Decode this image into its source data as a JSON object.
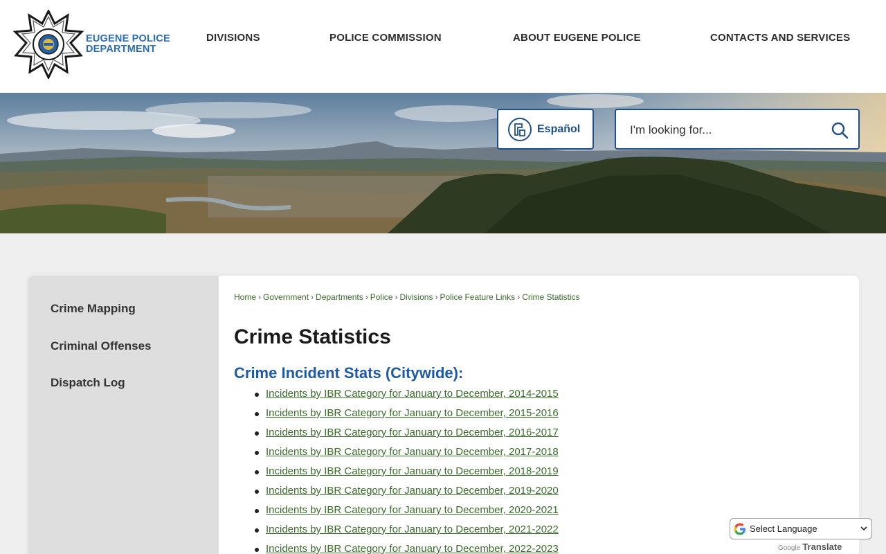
{
  "header": {
    "logo_line1": "EUGENE POLICE",
    "logo_line2": "DEPARTMENT",
    "nav": [
      {
        "label": "DIVISIONS"
      },
      {
        "label": "POLICE COMMISSION"
      },
      {
        "label": "ABOUT EUGENE POLICE"
      },
      {
        "label": "CONTACTS AND SERVICES"
      }
    ]
  },
  "banner": {
    "language_button": "Español",
    "search_placeholder": "I'm looking for..."
  },
  "sidebar": {
    "items": [
      {
        "label": "Crime Mapping"
      },
      {
        "label": "Criminal Offenses"
      },
      {
        "label": "Dispatch Log"
      }
    ]
  },
  "breadcrumb": [
    "Home",
    "Government",
    "Departments",
    "Police",
    "Divisions",
    "Police Feature Links",
    "Crime Statistics"
  ],
  "main": {
    "title": "Crime Statistics",
    "section_title": "Crime Incident Stats (Citywide):",
    "links": [
      "Incidents by IBR Category for January to December, 2014-2015",
      "Incidents by IBR Category for January to December, 2015-2016",
      "Incidents by IBR Category for January to December, 2016-2017",
      "Incidents by IBR Category for January to December, 2017-2018",
      "Incidents by IBR Category for January to December, 2018-2019",
      "Incidents by IBR Category for January to December, 2019-2020",
      "Incidents by IBR Category for January to December, 2020-2021",
      "Incidents by IBR Category for January to December, 2021-2022",
      "Incidents by IBR Category for January to December, 2022-2023"
    ]
  },
  "translate": {
    "select_label": "Select Language",
    "powered_google": "Google",
    "powered_translate": "Translate"
  },
  "colors": {
    "brand_blue": "#1f4f8a",
    "logo_blue": "#2a6ebb",
    "section_blue": "#1f5aa6",
    "link_green": "#3b6b2b",
    "sidebar_bg": "#dedede"
  },
  "icons": {
    "badge": "police-star-badge-icon",
    "language": "language-translate-icon",
    "search": "magnifier-search-icon",
    "google": "google-g-icon",
    "caret": "chevron-down-icon"
  }
}
